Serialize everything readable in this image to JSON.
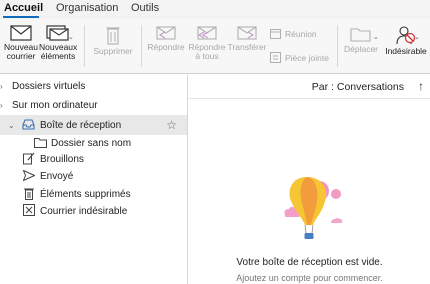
{
  "tabs": [
    {
      "label": "Accueil",
      "active": true
    },
    {
      "label": "Organisation",
      "active": false
    },
    {
      "label": "Outils",
      "active": false
    }
  ],
  "ribbon": {
    "new_mail": [
      "Nouveau",
      "courrier"
    ],
    "new_items": [
      "Nouveaux",
      "éléments"
    ],
    "delete": "Supprimer",
    "reply": "Répondre",
    "reply_all": [
      "Répondre",
      "à tous"
    ],
    "forward": "Transférer",
    "meeting": "Réunion",
    "attachment": "Pièce jointe",
    "move": "Déplacer",
    "junk": "Indésirable"
  },
  "sidebar": {
    "virtual_folders": "Dossiers virtuels",
    "on_my_computer": "Sur mon ordinateur",
    "items": [
      {
        "label": "Boîte de réception",
        "icon": "inbox-icon",
        "selected": true
      },
      {
        "label": "Dossier sans nom",
        "icon": "folder-icon",
        "selected": false
      },
      {
        "label": "Brouillons",
        "icon": "drafts-icon",
        "selected": false
      },
      {
        "label": "Envoyé",
        "icon": "sent-icon",
        "selected": false
      },
      {
        "label": "Éléments supprimés",
        "icon": "trash-icon",
        "selected": false
      },
      {
        "label": "Courrier indésirable",
        "icon": "junk-icon",
        "selected": false
      }
    ]
  },
  "main": {
    "sort_label": "Par : Conversations",
    "sort_arrow": "↑",
    "empty_title": "Votre boîte de réception est vide.",
    "empty_subtitle": "Ajoutez un compte pour commencer."
  },
  "colors": {
    "accent": "#0f6cbd",
    "balloon_yellow": "#f6c534",
    "balloon_orange": "#f39c3c",
    "balloon_pink": "#ef7fb5"
  }
}
